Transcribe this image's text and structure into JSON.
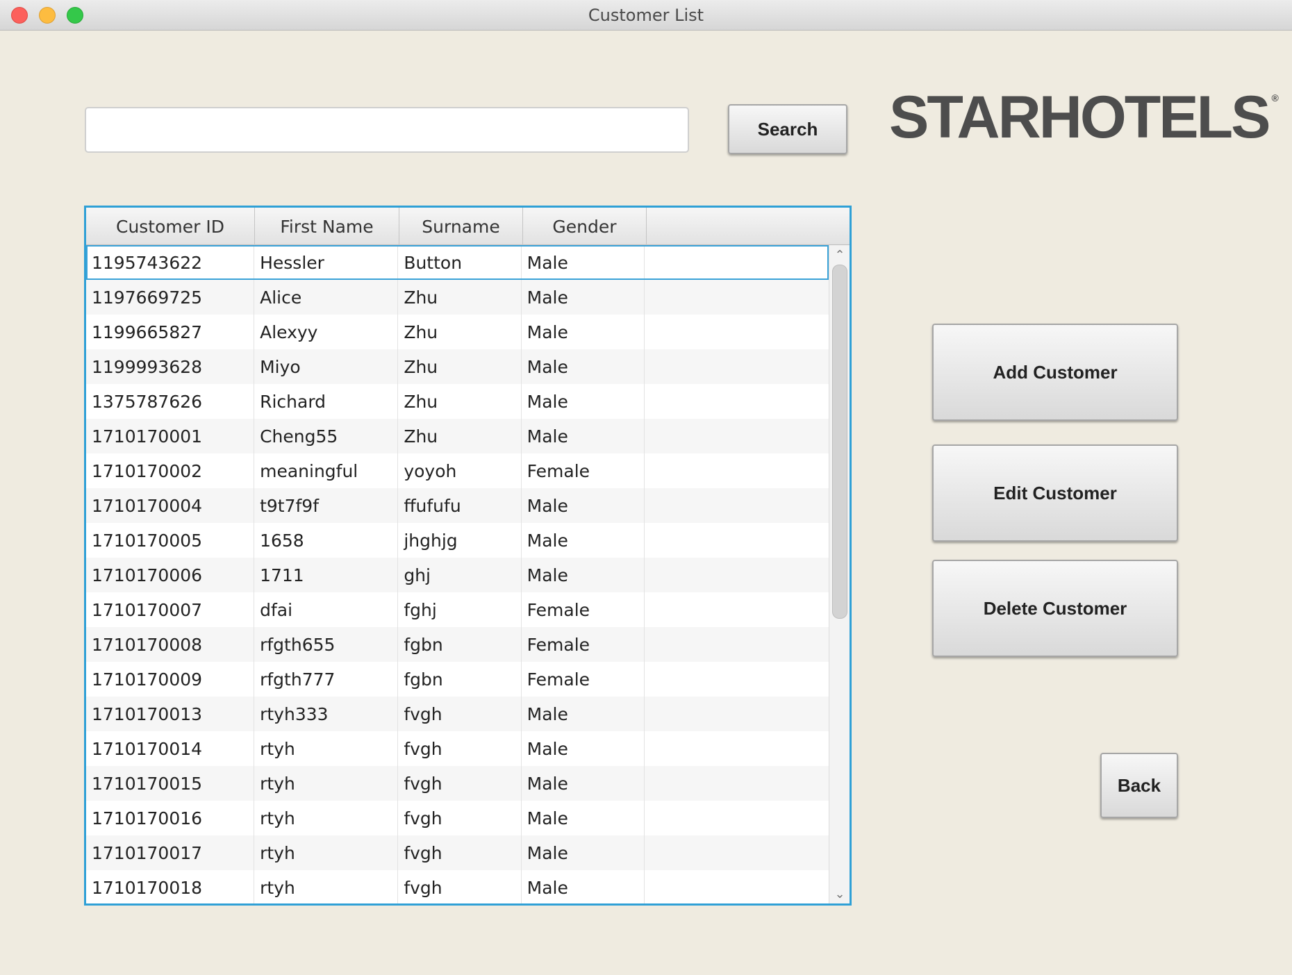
{
  "window": {
    "title": "Customer List"
  },
  "search": {
    "placeholder": "",
    "value": "",
    "button_label": "Search"
  },
  "logo": {
    "text": "STARHOTELS",
    "mark": "®"
  },
  "actions": {
    "add_label": "Add Customer",
    "edit_label": "Edit Customer",
    "delete_label": "Delete Customer",
    "back_label": "Back"
  },
  "table": {
    "columns": [
      "Customer ID",
      "First Name",
      "Surname",
      "Gender",
      ""
    ],
    "rows": [
      [
        "1195743622",
        "Hessler",
        "Button",
        "Male"
      ],
      [
        "1197669725",
        "Alice",
        "Zhu",
        "Male"
      ],
      [
        "1199665827",
        "Alexyy",
        "Zhu",
        "Male"
      ],
      [
        "1199993628",
        "Miyo",
        "Zhu",
        "Male"
      ],
      [
        "1375787626",
        "Richard",
        "Zhu",
        "Male"
      ],
      [
        "1710170001",
        "Cheng55",
        "Zhu",
        "Male"
      ],
      [
        "1710170002",
        "meaningful",
        "yoyoh",
        "Female"
      ],
      [
        "1710170004",
        "t9t7f9f",
        "ffufufu",
        "Male"
      ],
      [
        "1710170005",
        "1658",
        "jhghjg",
        "Male"
      ],
      [
        "1710170006",
        "1711",
        "ghj",
        "Male"
      ],
      [
        "1710170007",
        "dfai",
        "fghj",
        "Female"
      ],
      [
        "1710170008",
        "rfgth655",
        "fgbn",
        "Female"
      ],
      [
        "1710170009",
        "rfgth777",
        "fgbn",
        "Female"
      ],
      [
        "1710170013",
        "rtyh333",
        "fvgh",
        "Male"
      ],
      [
        "1710170014",
        "rtyh",
        "fvgh",
        "Male"
      ],
      [
        "1710170015",
        "rtyh",
        "fvgh",
        "Male"
      ],
      [
        "1710170016",
        "rtyh",
        "fvgh",
        "Male"
      ],
      [
        "1710170017",
        "rtyh",
        "fvgh",
        "Male"
      ],
      [
        "1710170018",
        "rtyh",
        "fvgh",
        "Male"
      ]
    ]
  },
  "colors": {
    "accent": "#2fa0d6",
    "background": "#efebe0"
  },
  "icons": {
    "scroll_up": "chevron-up-icon",
    "scroll_down": "chevron-down-icon"
  }
}
